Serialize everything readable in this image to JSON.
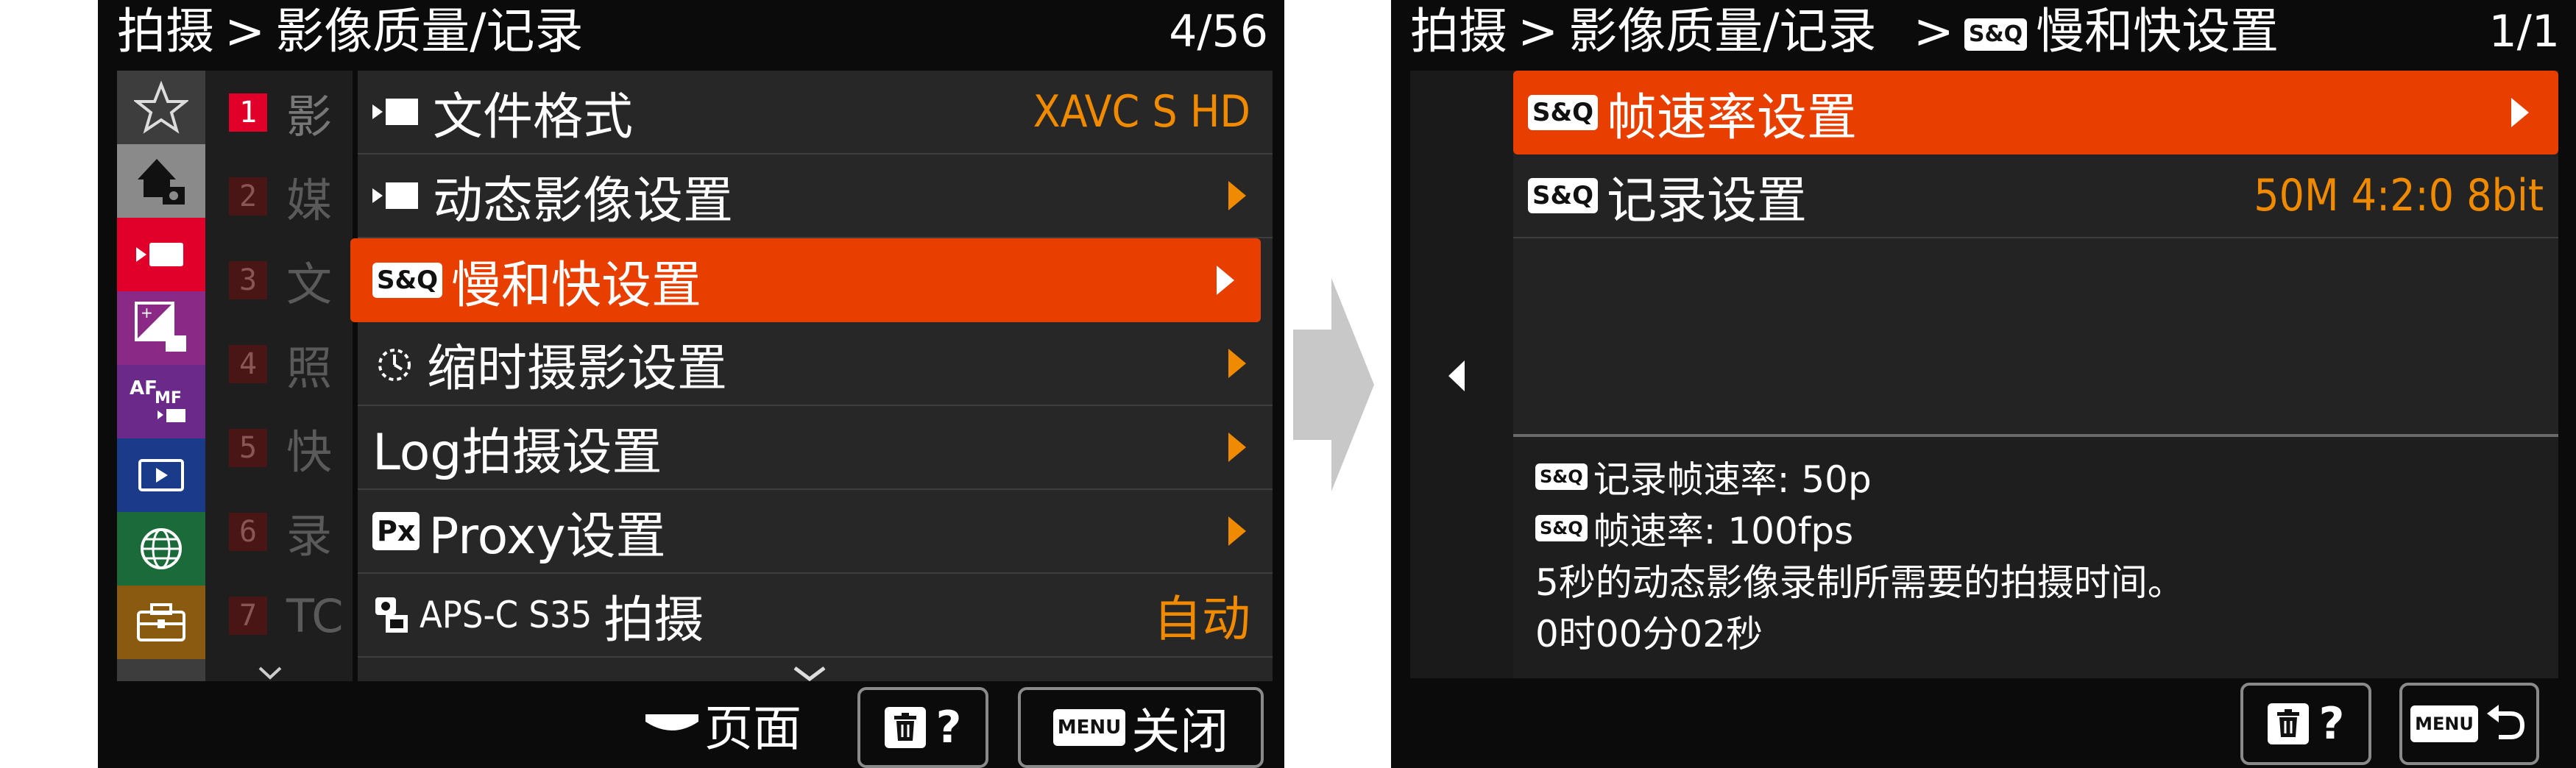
{
  "left_screen": {
    "breadcrumb": [
      "拍摄",
      "影像质量/记录"
    ],
    "separator": ">",
    "page_indicator": "4/56",
    "sidebar_tabs": [
      "star-icon",
      "home-camera-icon",
      "movie-icon",
      "exposure-icon",
      "af-mf-icon",
      "playback-icon",
      "network-icon",
      "toolbox-icon"
    ],
    "number_items": [
      {
        "num": "1",
        "label": "影"
      },
      {
        "num": "2",
        "label": "媒"
      },
      {
        "num": "3",
        "label": "文"
      },
      {
        "num": "4",
        "label": "照"
      },
      {
        "num": "5",
        "label": "快"
      },
      {
        "num": "6",
        "label": "录"
      },
      {
        "num": "7",
        "label": "TC"
      }
    ],
    "menu_items": [
      {
        "label": "文件格式",
        "value": "XAVC S HD",
        "icon": "movie-mode-icon"
      },
      {
        "label": "动态影像设置",
        "icon": "movie-mode-icon"
      },
      {
        "label": "慢和快设置",
        "icon": "sq-icon"
      },
      {
        "label": "缩时摄影设置",
        "icon": "timelapse-icon"
      },
      {
        "label": "Log拍摄设置"
      },
      {
        "label": "Proxy设置",
        "icon": "proxy-icon"
      },
      {
        "prefix": "APS-C S35",
        "label": "拍摄",
        "value": "自动",
        "icon": "apsc-icon"
      }
    ],
    "sq_badge": "S&Q",
    "px_badge": "Px",
    "footer": {
      "page_label": "页面",
      "delete_help": "?",
      "menu_badge": "MENU",
      "close_label": "关闭"
    }
  },
  "right_screen": {
    "breadcrumb": [
      "拍摄",
      "影像质量/记录",
      "慢和快设置"
    ],
    "separator": ">",
    "page_indicator": "1/1",
    "menu_items": [
      {
        "label": "帧速率设置"
      },
      {
        "label": "记录设置",
        "value": "50M 4:2:0 8bit"
      }
    ],
    "info_lines": [
      "记录帧速率: 50p",
      "帧速率: 100fps",
      "5秒的动态影像录制所需要的拍摄时间。",
      "0时00分02秒"
    ],
    "footer": {
      "delete_help": "?",
      "menu_badge": "MENU"
    }
  },
  "colors": {
    "accent": "#e83f00",
    "value_orange": "#f08a00",
    "background": "#0b0b0b",
    "arrow_gray": "#c8c8c8"
  }
}
